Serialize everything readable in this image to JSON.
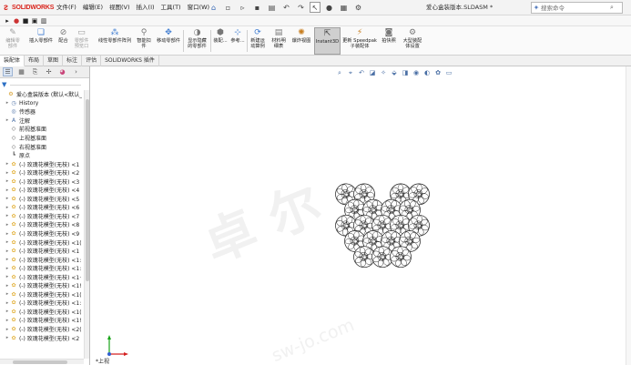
{
  "app": {
    "logo_text": "SOLIDWORKS",
    "doc_title": "爱心盒装版本.SLDASM *",
    "search_placeholder": "搜索命令"
  },
  "menu": [
    "文件(F)",
    "编辑(E)",
    "视图(V)",
    "插入(I)",
    "工具(T)",
    "窗口(W)"
  ],
  "ribbon": {
    "commands": [
      {
        "label": "编辑零\n部件",
        "icon": "edit-component-icon",
        "enabled": false
      },
      {
        "label": "插入零部件",
        "icon": "insert-component-icon",
        "enabled": true
      },
      {
        "label": "配合",
        "icon": "mate-icon",
        "enabled": true
      },
      {
        "label": "零部件\n预览口",
        "icon": "component-preview-icon",
        "enabled": false
      },
      {
        "label": "线性零部件阵列",
        "icon": "linear-pattern-icon",
        "enabled": true
      },
      {
        "label": "智能扣\n件",
        "icon": "smart-fasteners-icon",
        "enabled": true
      },
      {
        "label": "移动零部件",
        "icon": "move-component-icon",
        "enabled": true
      },
      {
        "label": "显示隐藏\n的零部件",
        "icon": "show-hidden-icon",
        "enabled": true
      },
      {
        "label": "装配...",
        "icon": "assembly-features-icon",
        "enabled": true
      },
      {
        "label": "参考...",
        "icon": "reference-geometry-icon",
        "enabled": true
      },
      {
        "label": "新建运\n动算例",
        "icon": "new-motion-study-icon",
        "enabled": true
      },
      {
        "label": "材料明\n细表",
        "icon": "bom-icon",
        "enabled": true
      },
      {
        "label": "爆炸视图",
        "icon": "exploded-view-icon",
        "enabled": true
      },
      {
        "label": "Instant3D",
        "icon": "instant3d-icon",
        "enabled": true,
        "active": true
      },
      {
        "label": "更新 Speedpak\n子装配体",
        "icon": "speedpak-icon",
        "enabled": true
      },
      {
        "label": "拍快照",
        "icon": "snapshot-icon",
        "enabled": true
      },
      {
        "label": "大型装配\n体设置",
        "icon": "large-assembly-icon",
        "enabled": true
      }
    ]
  },
  "command_tabs": [
    {
      "label": "装配体",
      "active": true
    },
    {
      "label": "布局"
    },
    {
      "label": "草图"
    },
    {
      "label": "标注"
    },
    {
      "label": "评估"
    },
    {
      "label": "SOLIDWORKS 插件"
    }
  ],
  "tree": {
    "items": [
      {
        "label": "爱心盒装版本 (默认<默认_",
        "icon": "assembly-icon",
        "expander": "",
        "indent": 0
      },
      {
        "label": "History",
        "icon": "history-icon",
        "expander": "▸",
        "indent": 1
      },
      {
        "label": "传感器",
        "icon": "sensor-icon",
        "expander": "",
        "indent": 1
      },
      {
        "label": "注解",
        "icon": "annotation-icon",
        "expander": "▸",
        "indent": 1
      },
      {
        "label": "前视基准面",
        "icon": "plane-icon",
        "expander": "",
        "indent": 1
      },
      {
        "label": "上视基准面",
        "icon": "plane-icon",
        "expander": "",
        "indent": 1
      },
      {
        "label": "右视基准面",
        "icon": "plane-icon",
        "expander": "",
        "indent": 1
      },
      {
        "label": "原点",
        "icon": "origin-icon",
        "expander": "",
        "indent": 1
      },
      {
        "label": "(-) 玫瑰花模型(无枝) <1",
        "icon": "part-icon",
        "expander": "▸",
        "indent": 1
      },
      {
        "label": "(-) 玫瑰花模型(无枝) <2",
        "icon": "part-icon",
        "expander": "▸",
        "indent": 1
      },
      {
        "label": "(-) 玫瑰花模型(无枝) <3",
        "icon": "part-icon",
        "expander": "▸",
        "indent": 1
      },
      {
        "label": "(-) 玫瑰花模型(无枝) <4",
        "icon": "part-icon",
        "expander": "▸",
        "indent": 1
      },
      {
        "label": "(-) 玫瑰花模型(无枝) <5",
        "icon": "part-icon",
        "expander": "▸",
        "indent": 1
      },
      {
        "label": "(-) 玫瑰花模型(无枝) <6",
        "icon": "part-icon",
        "expander": "▸",
        "indent": 1
      },
      {
        "label": "(-) 玫瑰花模型(无枝) <7",
        "icon": "part-icon",
        "expander": "▸",
        "indent": 1
      },
      {
        "label": "(-) 玫瑰花模型(无枝) <8",
        "icon": "part-icon",
        "expander": "▸",
        "indent": 1
      },
      {
        "label": "(-) 玫瑰花模型(无枝) <9",
        "icon": "part-icon",
        "expander": "▸",
        "indent": 1
      },
      {
        "label": "(-) 玫瑰花模型(无枝) <1(",
        "icon": "part-icon",
        "expander": "▸",
        "indent": 1
      },
      {
        "label": "(-) 玫瑰花模型(无枝) <1",
        "icon": "part-icon",
        "expander": "▸",
        "indent": 1
      },
      {
        "label": "(-) 玫瑰花模型(无枝) <1:",
        "icon": "part-icon",
        "expander": "▸",
        "indent": 1
      },
      {
        "label": "(-) 玫瑰花模型(无枝) <1:",
        "icon": "part-icon",
        "expander": "▸",
        "indent": 1
      },
      {
        "label": "(-) 玫瑰花模型(无枝) <1·",
        "icon": "part-icon",
        "expander": "▸",
        "indent": 1
      },
      {
        "label": "(-) 玫瑰花模型(无枝) <1!",
        "icon": "part-icon",
        "expander": "▸",
        "indent": 1
      },
      {
        "label": "(-) 玫瑰花模型(无枝) <1(",
        "icon": "part-icon",
        "expander": "▸",
        "indent": 1
      },
      {
        "label": "(-) 玫瑰花模型(无枝) <1:",
        "icon": "part-icon",
        "expander": "▸",
        "indent": 1
      },
      {
        "label": "(-) 玫瑰花模型(无枝) <1(",
        "icon": "part-icon",
        "expander": "▸",
        "indent": 1
      },
      {
        "label": "(-) 玫瑰花模型(无枝) <1!",
        "icon": "part-icon",
        "expander": "▸",
        "indent": 1
      },
      {
        "label": "(-) 玫瑰花模型(无枝) <2(",
        "icon": "part-icon",
        "expander": "▸",
        "indent": 1
      },
      {
        "label": "(-) 玫瑰花模型(无枝) <2",
        "icon": "part-icon",
        "expander": "▸",
        "indent": 1
      }
    ]
  },
  "graphics": {
    "view_label": "*上视",
    "watermark": "卓尔",
    "watermark_sub": "sw-jo.com"
  },
  "colors": {
    "accent": "#d9241c",
    "part_icon": "#e3b23c",
    "rose_outline": "#222222"
  }
}
